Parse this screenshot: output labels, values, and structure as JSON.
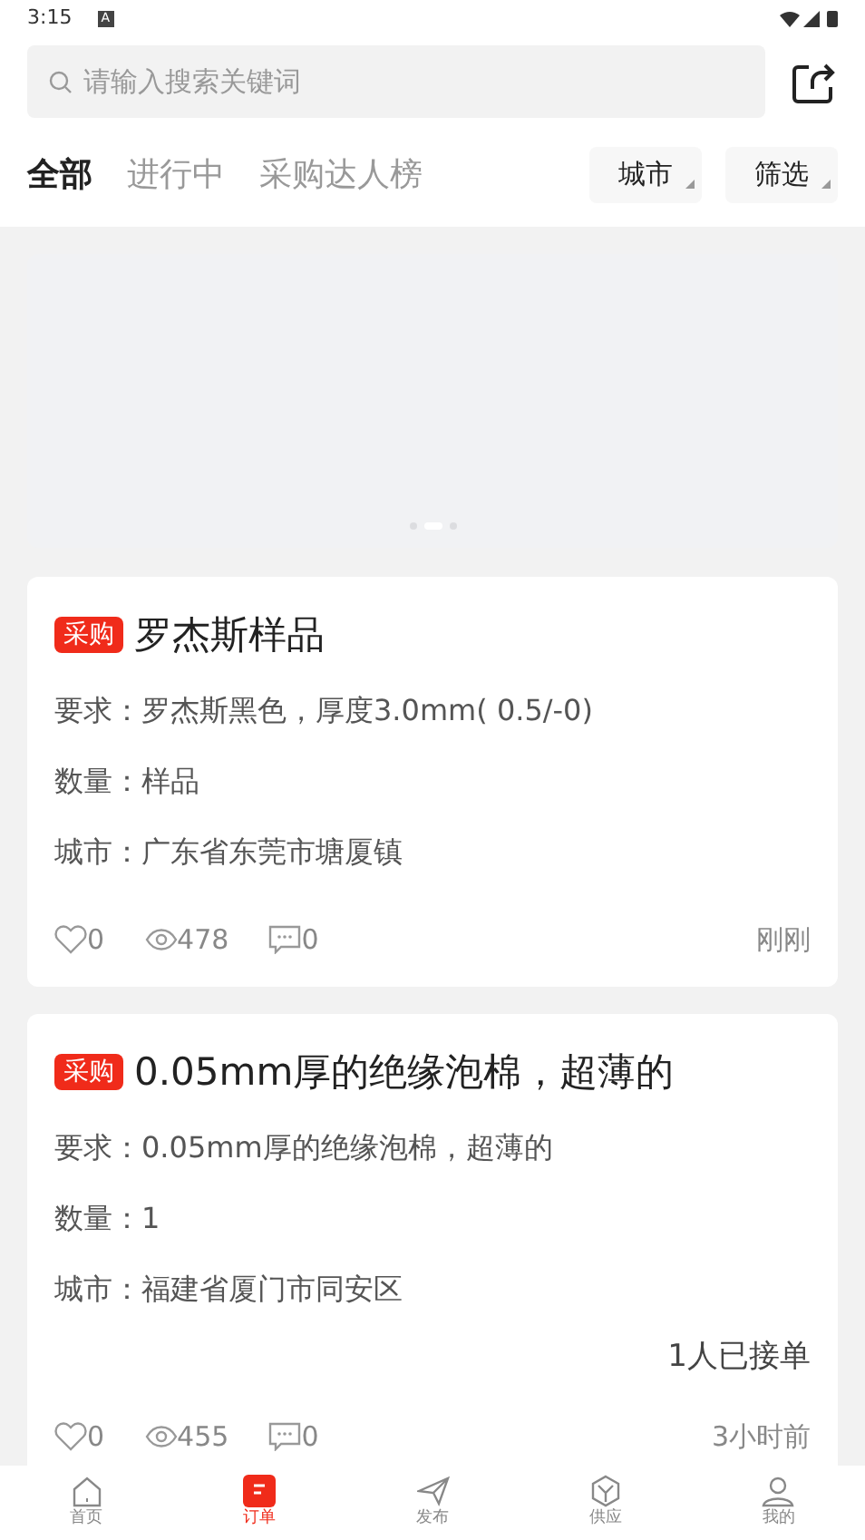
{
  "status_bar": {
    "time": "3:15",
    "notification": "A"
  },
  "search": {
    "placeholder": "请输入搜索关键词"
  },
  "tabs": [
    {
      "label": "全部",
      "selected": true
    },
    {
      "label": "进行中",
      "selected": false
    },
    {
      "label": "采购达人榜",
      "selected": false
    }
  ],
  "filters": [
    "城市",
    "筛选"
  ],
  "banner": {
    "dots": [
      {
        "selected": false
      },
      {
        "selected": true
      },
      {
        "selected": false
      }
    ]
  },
  "cards": [
    {
      "tag": "采购",
      "title": "罗杰斯样品",
      "lines": [
        "要求：罗杰斯黑色，厚度3.0mm( 0.5/-0)",
        "数量：样品",
        "城市：广东省东莞市塘厦镇"
      ],
      "likes": "0",
      "views": "478",
      "comments": "0",
      "time": "刚刚"
    },
    {
      "tag": "采购",
      "title": "0.05mm厚的绝缘泡棉，超薄的",
      "lines": [
        "要求：0.05mm厚的绝缘泡棉，超薄的",
        "数量：1",
        "城市：福建省厦门市同安区"
      ],
      "accepted": "1人已接单",
      "likes": "0",
      "views": "455",
      "comments": "0",
      "time": "3小时前"
    }
  ],
  "nav": [
    {
      "label": "首页",
      "selected": false
    },
    {
      "label": "订单",
      "selected": true
    },
    {
      "label": "发布",
      "selected": false
    },
    {
      "label": "供应",
      "selected": false
    },
    {
      "label": "我的",
      "selected": false
    }
  ]
}
